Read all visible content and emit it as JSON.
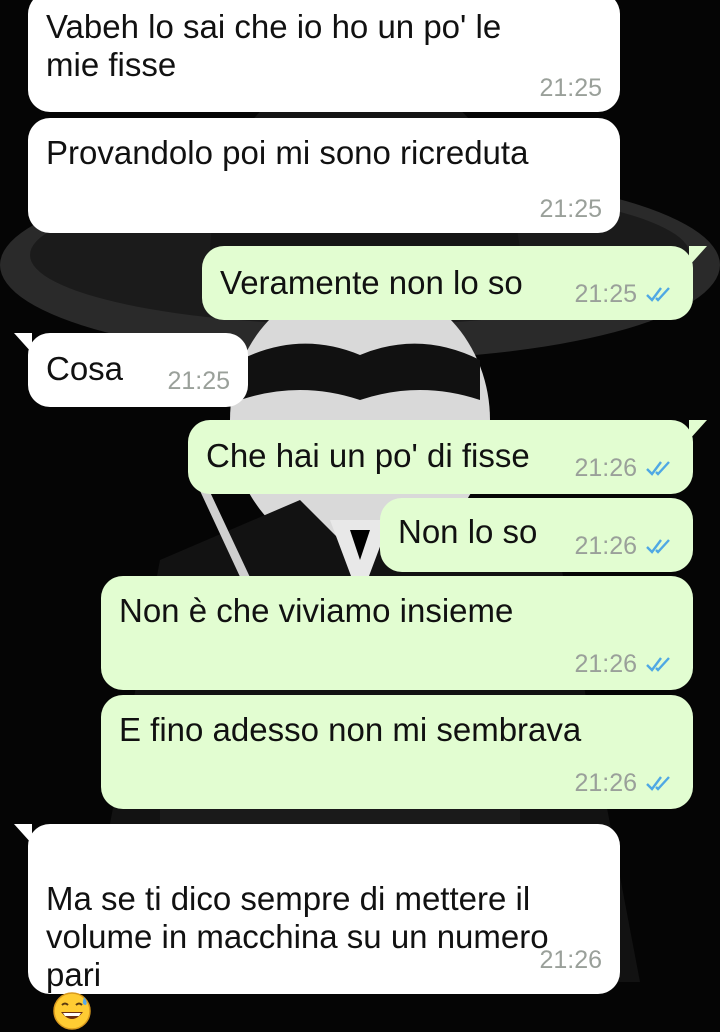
{
  "messages": [
    {
      "id": "m1",
      "dir": "in",
      "text": "Vabeh lo sai che io ho un po' le\nmie fisse",
      "time": "21:25",
      "ticks": false
    },
    {
      "id": "m2",
      "dir": "in",
      "text": "Provandolo poi mi sono ricreduta",
      "time": "21:25",
      "ticks": false
    },
    {
      "id": "m3",
      "dir": "out",
      "text": "Veramente non lo so",
      "time": "21:25",
      "ticks": true
    },
    {
      "id": "m4",
      "dir": "in",
      "text": "Cosa",
      "time": "21:25",
      "ticks": false
    },
    {
      "id": "m5",
      "dir": "out",
      "text": "Che hai un po' di fisse",
      "time": "21:26",
      "ticks": true
    },
    {
      "id": "m6",
      "dir": "out",
      "text": "Non lo so",
      "time": "21:26",
      "ticks": true
    },
    {
      "id": "m7",
      "dir": "out",
      "text": "Non è che viviamo insieme",
      "time": "21:26",
      "ticks": true
    },
    {
      "id": "m8",
      "dir": "out",
      "text": "E fino adesso non mi sembrava",
      "time": "21:26",
      "ticks": true
    },
    {
      "id": "m9",
      "dir": "in",
      "text": "Ma se ti dico sempre di mettere il\nvolume in macchina su un numero\npari",
      "time": "21:26",
      "ticks": false,
      "emoji": "grinning-sweat-emoji"
    }
  ],
  "colors": {
    "incoming": "#ffffff",
    "outgoing": "#e2fdd1",
    "read_ticks": "#4fa8e4",
    "timestamp": "#9aa09a"
  },
  "icons": {
    "read_receipt": "double-check-icon",
    "emoji": "grinning-face-with-sweat-emoji"
  }
}
